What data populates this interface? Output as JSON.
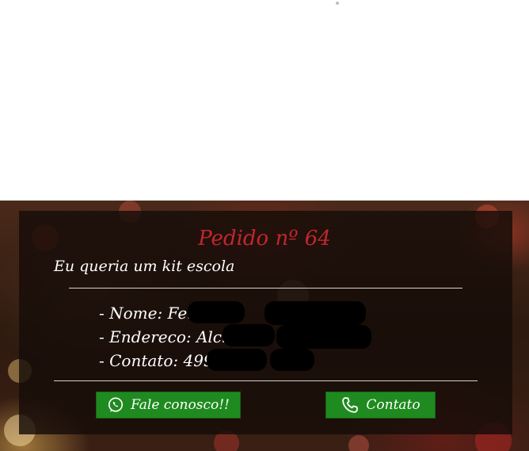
{
  "order": {
    "title": "Pedido nº 64",
    "message": "Eu queria um kit escola",
    "details": [
      {
        "text": "- Nome: Fer          Ribe"
      },
      {
        "text": "- Endereco: Alci            l"
      },
      {
        "text": "- Contato: 499          04"
      }
    ]
  },
  "buttons": {
    "whatsapp_label": "Fale conosco!!",
    "whatsapp_icon": "whatsapp-icon",
    "contact_label": "Contato",
    "contact_icon": "phone-icon"
  },
  "colors": {
    "accent_red": "#c0272d",
    "button_green": "#1f8a1f",
    "card_background": "#160c08"
  }
}
